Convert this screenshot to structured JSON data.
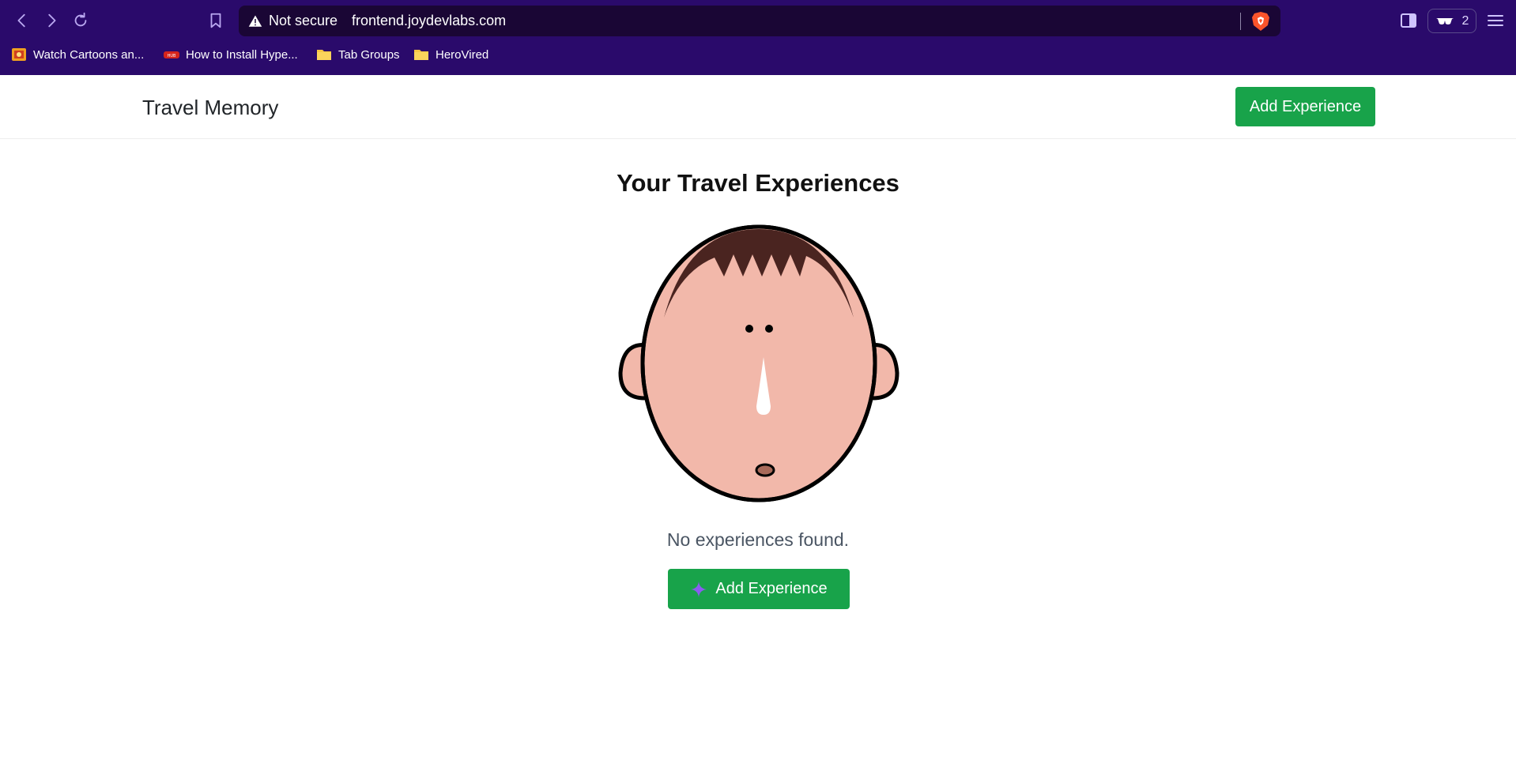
{
  "browser": {
    "security_label": "Not secure",
    "url": "frontend.joydevlabs.com",
    "wallet_count": "2",
    "bookmarks": [
      {
        "label": "Watch Cartoons an...",
        "icon": "cartoon-site-icon"
      },
      {
        "label": "How to Install Hype...",
        "icon": "hub-site-icon"
      },
      {
        "label": "Tab Groups",
        "icon": "folder-icon"
      },
      {
        "label": "HeroVired",
        "icon": "folder-icon"
      }
    ],
    "colors": {
      "chrome_bg": "#2a0a6b",
      "urlbar_bg": "#1a0635"
    }
  },
  "navbar": {
    "brand": "Travel Memory",
    "add_button": "Add Experience"
  },
  "main": {
    "heading": "Your Travel Experiences",
    "empty_message": "No experiences found.",
    "add_button": "Add Experience",
    "illustration": "cartoon-face-illustration"
  },
  "colors": {
    "accent_green": "#18a34a",
    "face_skin": "#f2b8aa",
    "hair": "#4a2420"
  }
}
